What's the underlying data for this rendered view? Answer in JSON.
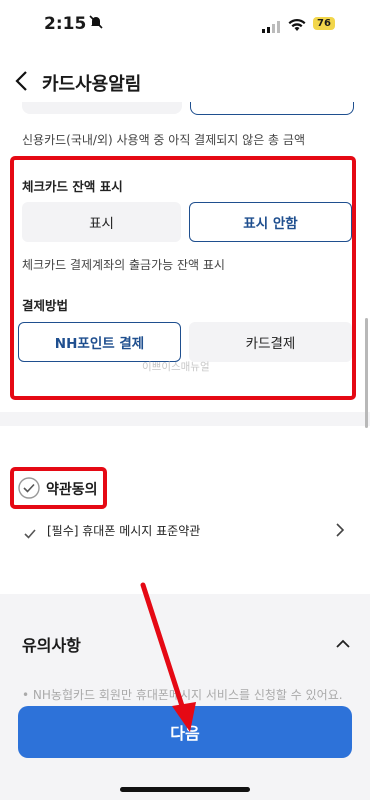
{
  "status_bar": {
    "time": "2:15",
    "battery": "76"
  },
  "nav": {
    "title": "카드사용알림"
  },
  "credit_desc": "신용카드(국내/외) 사용액 중 아직 결제되지 않은 총 금액",
  "check_balance": {
    "label": "체크카드 잔액 표시",
    "options": [
      "표시",
      "표시 안함"
    ],
    "selected": "표시 안함",
    "hint": "체크카드 결제계좌의 출금가능 잔액 표시"
  },
  "payment_method": {
    "label": "결제방법",
    "options": [
      "NH포인트 결제",
      "카드결제"
    ],
    "selected": "NH포인트 결제"
  },
  "watermark": "이쁘이스매뉴얼",
  "agreement": {
    "label": "약관동의",
    "terms": [
      {
        "label": "[필수] 휴대폰 메시지 표준약관"
      }
    ]
  },
  "notice": {
    "title": "유의사항",
    "items": [
      "NH농협카드 회원만 휴대폰메시지 서비스를 신청할 수 있어요."
    ]
  },
  "next_button": "다음",
  "colors": {
    "accent": "#2d72d9",
    "selected_border": "#1f4f8f",
    "annotation_red": "#e50914"
  }
}
